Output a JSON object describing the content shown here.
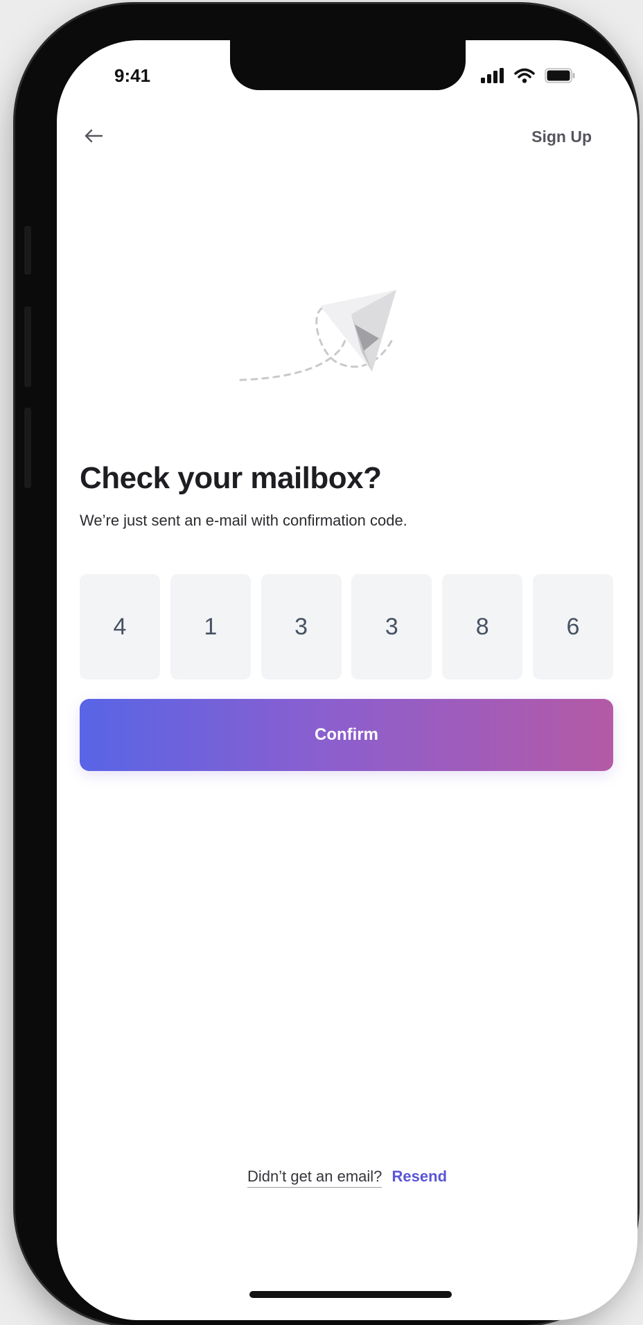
{
  "status_bar": {
    "time": "9:41",
    "icons": [
      "signal-icon",
      "wifi-icon",
      "battery-icon"
    ]
  },
  "nav": {
    "back_icon": "arrow-left-icon",
    "signup_label": "Sign Up"
  },
  "illustration": "paper-plane-illustration",
  "main": {
    "title": "Check your mailbox?",
    "subtitle": "We’re just sent an e-mail with confirmation code.",
    "code_digits": [
      "4",
      "1",
      "3",
      "3",
      "8",
      "6"
    ],
    "confirm_label": "Confirm"
  },
  "footer": {
    "question": "Didn’t get an email?",
    "resend_label": "Resend"
  },
  "colors": {
    "gradient_start": "#5865e6",
    "gradient_end": "#b45aa6",
    "resend_link": "#5b55d6",
    "code_box_bg": "#f3f4f6"
  }
}
